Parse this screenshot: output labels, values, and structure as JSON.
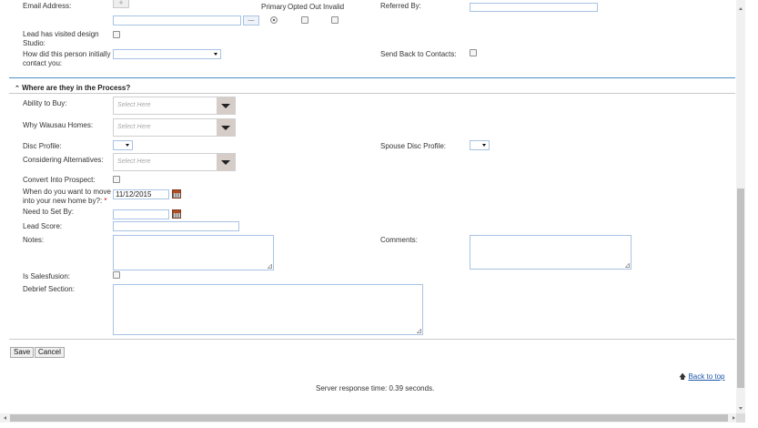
{
  "email_section": {
    "email_label": "Email Address:",
    "plus_label": "+",
    "minus_label": "—",
    "email_value": "",
    "col_primary": "Primary",
    "col_opted_out": "Opted Out",
    "col_invalid": "Invalid",
    "referred_by_label": "Referred By:",
    "referred_by_value": "",
    "lead_visited_label_1": "Lead has visited design",
    "lead_visited_label_2": "Studio:",
    "initial_contact_label_1": "How did this person initially",
    "initial_contact_label_2": "contact you:",
    "initial_contact_value": "",
    "send_back_label": "Send Back to Contacts:"
  },
  "process_section": {
    "header": "Where are they in the Process?",
    "ability_label": "Ability to Buy:",
    "why_label": "Why Wausau Homes:",
    "select_placeholder": "Select Here",
    "disc_label": "Disc Profile:",
    "spouse_disc_label": "Spouse Disc Profile:",
    "considering_label": "Considering Alternatives:",
    "convert_label": "Convert Into Prospect:",
    "move_label_1": "When do you want to move",
    "move_label_2": "into your new home by?:",
    "required_mark": "*",
    "move_value": "11/12/2015",
    "need_set_label": "Need to Set By:",
    "need_set_value": "",
    "lead_score_label": "Lead Score:",
    "lead_score_value": "",
    "notes_label": "Notes:",
    "comments_label": "Comments:",
    "salesfusion_label": "Is Salesfusion:",
    "debrief_label": "Debrief Section:"
  },
  "actions": {
    "save_label": "Save",
    "cancel_label": "Cancel"
  },
  "footer": {
    "back_to_top": "Back to top",
    "server_response": "Server response time: 0.39 seconds."
  },
  "colors": {
    "accent_border": "#4a90c8",
    "required": "#cc0000",
    "link": "#1a56a8",
    "scroll_thumb": "#c1c1c1"
  }
}
